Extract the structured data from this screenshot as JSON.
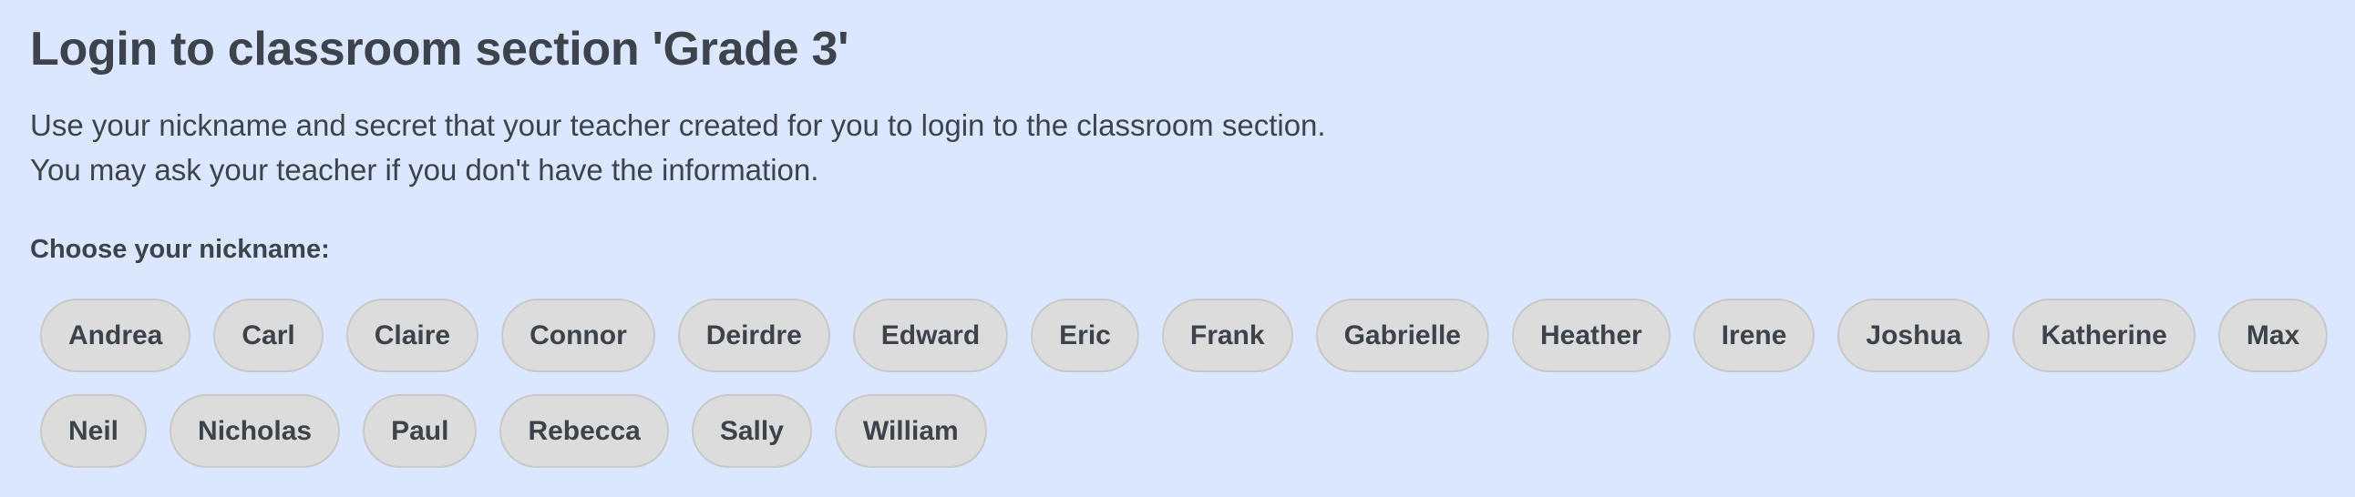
{
  "header": {
    "title": "Login to classroom section 'Grade 3'"
  },
  "intro": {
    "line1": "Use your nickname and secret that your teacher created for you to login to the classroom section.",
    "line2": "You may ask your teacher if you don't have the information."
  },
  "nickname_picker": {
    "label": "Choose your nickname:",
    "rows": [
      [
        "Andrea",
        "Carl",
        "Claire",
        "Connor",
        "Deirdre",
        "Edward",
        "Eric",
        "Frank",
        "Gabrielle",
        "Heather",
        "Irene",
        "Joshua",
        "Katherine",
        "Max"
      ],
      [
        "Neil",
        "Nicholas",
        "Paul",
        "Rebecca",
        "Sally",
        "William"
      ]
    ]
  },
  "colors": {
    "background": "#dbe7ff",
    "text": "#3c434b",
    "pill_background": "#dcdcdc",
    "pill_border": "#c9c9c9"
  }
}
